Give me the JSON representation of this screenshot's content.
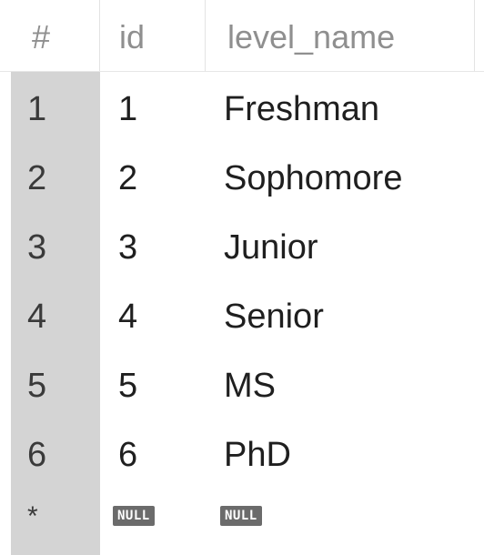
{
  "columns": {
    "row_number": "#",
    "id": "id",
    "level_name": "level_name"
  },
  "rows": [
    {
      "num": "1",
      "id": "1",
      "level_name": "Freshman"
    },
    {
      "num": "2",
      "id": "2",
      "level_name": "Sophomore"
    },
    {
      "num": "3",
      "id": "3",
      "level_name": "Junior"
    },
    {
      "num": "4",
      "id": "4",
      "level_name": "Senior"
    },
    {
      "num": "5",
      "id": "5",
      "level_name": "MS"
    },
    {
      "num": "6",
      "id": "6",
      "level_name": "PhD"
    }
  ],
  "new_row": {
    "marker": "*",
    "id": "NULL",
    "level_name": "NULL"
  },
  "colors": {
    "gutter": "#d4d4d4",
    "null_badge": "#6b6b6b",
    "header_text": "#8f8f8f"
  }
}
